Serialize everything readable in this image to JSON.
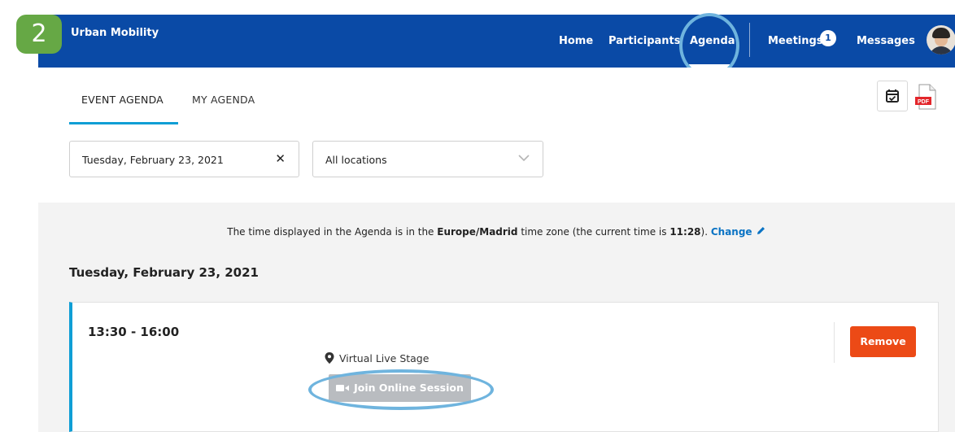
{
  "header": {
    "brand": "Urban Mobility",
    "nav": {
      "home": "Home",
      "participants": "Participants",
      "agenda": "Agenda",
      "meetings": "Meetings",
      "meetings_count": "1",
      "messages": "Messages"
    },
    "step_number": "2",
    "brand_color": "#0a4aa6"
  },
  "tabs": {
    "event_agenda": "EVENT AGENDA",
    "my_agenda": "MY AGENDA",
    "pdf_icon_text": "PDF"
  },
  "filters": {
    "date_value": "Tuesday, February 23, 2021",
    "location_value": "All locations"
  },
  "timezone_note": {
    "prefix": "The time displayed in the Agenda is in the ",
    "zone": "Europe/Madrid",
    "middle": " time zone (the current time is ",
    "current_time": "11:28",
    "suffix": "). ",
    "change_label": "Change"
  },
  "day_heading": "Tuesday, February 23, 2021",
  "session": {
    "time": "13:30 - 16:00",
    "location": "Virtual Live Stage",
    "join_label": "Join Online Session",
    "remove_label": "Remove",
    "remove_color": "#ec4a16",
    "accent_color": "#0f9ed5"
  }
}
